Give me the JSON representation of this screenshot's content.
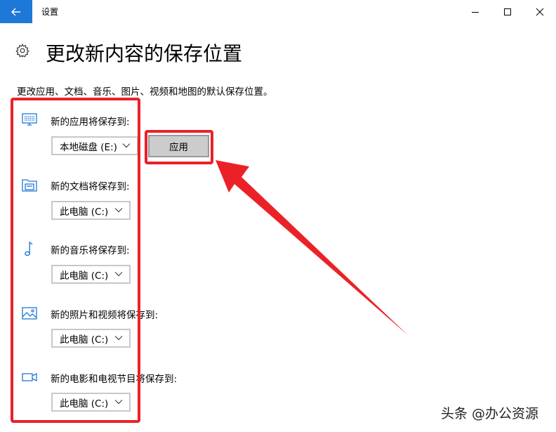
{
  "window": {
    "title": "设置"
  },
  "header": {
    "page_title": "更改新内容的保存位置",
    "description": "更改应用、文档、音乐、图片、视频和地图的默认保存位置。"
  },
  "sections": [
    {
      "label": "新的应用将保存到:",
      "selected": "本地磁盘 (E:)",
      "icon": "monitor-icon"
    },
    {
      "label": "新的文档将保存到:",
      "selected": "此电脑 (C:)",
      "icon": "folder-documents-icon"
    },
    {
      "label": "新的音乐将保存到:",
      "selected": "此电脑 (C:)",
      "icon": "music-note-icon"
    },
    {
      "label": "新的照片和视频将保存到:",
      "selected": "此电脑 (C:)",
      "icon": "picture-icon"
    },
    {
      "label": "新的电影和电视节目将保存到:",
      "selected": "此电脑 (C:)",
      "icon": "video-camera-icon"
    }
  ],
  "apply_button": {
    "label": "应用"
  },
  "watermark": "头条 @办公资源",
  "colors": {
    "accent": "#1e78d7",
    "annotation_red": "#ea2228",
    "button_gray": "#cccccc"
  }
}
